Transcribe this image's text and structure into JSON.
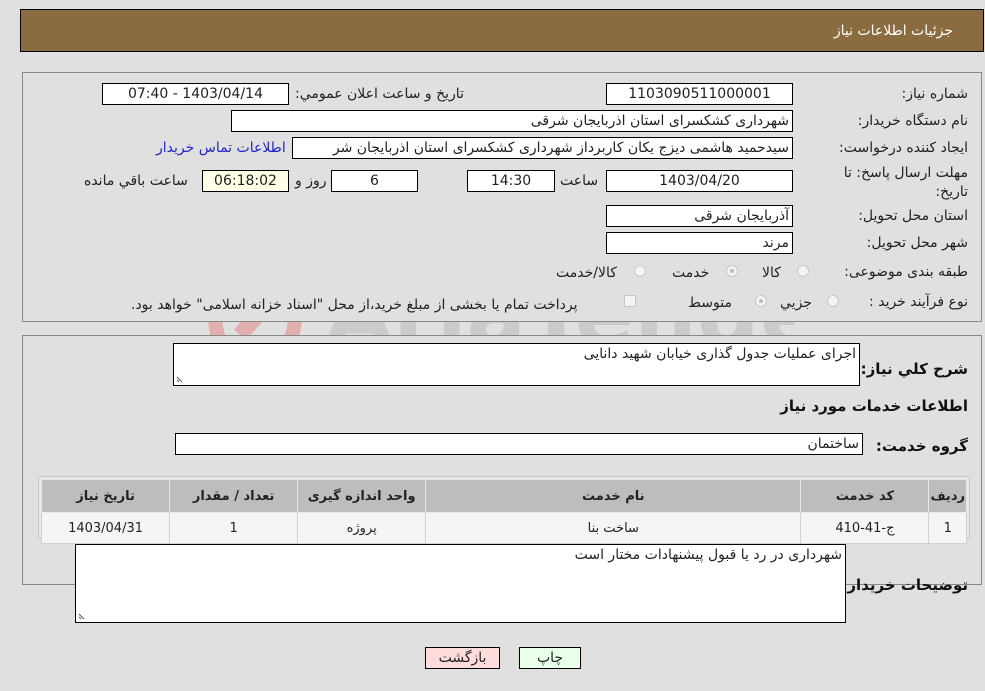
{
  "header": {
    "title": "جزئیات اطلاعات نیاز"
  },
  "form": {
    "need_number": {
      "label": "شماره نیاز:",
      "value": "1103090511000001"
    },
    "announce_datetime": {
      "label": "تاریخ و ساعت اعلان عمومي:",
      "value": "1403/04/14 - 07:40"
    },
    "buyer_org": {
      "label": "نام دستگاه خريدار:",
      "value": "شهرداری کشکسرای استان اذربایجان شرقی"
    },
    "requester": {
      "label": "ایجاد کننده درخواست:",
      "value": "سیدحمید هاشمی دیزج یکان کاربرداز شهرداری کشکسرای استان اذربایجان شر"
    },
    "buyer_contact_link": "اطلاعات تماس خريدار",
    "deadline": {
      "label": "مهلت ارسال پاسخ: تا تاریخ:",
      "date": "1403/04/20",
      "time_label": "ساعت",
      "time": "14:30",
      "days": "6",
      "days_label": "روز و",
      "remaining": "06:18:02",
      "remaining_label": "ساعت باقي مانده"
    },
    "delivery_province": {
      "label": "استان محل تحویل:",
      "value": "آذربایجان شرقی"
    },
    "delivery_city": {
      "label": "شهر محل تحویل:",
      "value": "مرند"
    },
    "category": {
      "label": "طبقه بندی موضوعی:",
      "options": [
        "کالا",
        "خدمت",
        "کالا/خدمت"
      ],
      "selected": "خدمت"
    },
    "purchase_type": {
      "label": "نوع فرآیند خرید :",
      "options": [
        "جزيي",
        "متوسط"
      ],
      "selected": "متوسط",
      "treasury_note": "پرداخت تمام یا بخشی از مبلغ خرید،از محل \"اسناد خزانه اسلامی\" خواهد بود."
    }
  },
  "details": {
    "description_label": "شرح كلي نياز:",
    "description": "اجرای عملیات جدول گذاری خیابان شهید دانایی",
    "services_heading": "اطلاعات خدمات مورد نياز",
    "service_group_label": "گروه خدمت:",
    "service_group": "ساختمان",
    "table": {
      "headers": [
        "رديف",
        "کد خدمت",
        "نام خدمت",
        "واحد اندازه گیری",
        "تعداد / مقدار",
        "تاریخ نیاز"
      ],
      "rows": [
        [
          "1",
          "ج-41-410",
          "ساخت بنا",
          "پروژه",
          "1",
          "1403/04/31"
        ]
      ]
    },
    "buyer_notes_label": "توضيحات خريدار:",
    "buyer_notes": "شهرداری در رد یا قبول پیشنهادات مختار است"
  },
  "buttons": {
    "print": "چاپ",
    "back": "بازگشت"
  },
  "colors": {
    "header_bg": "#8b6b40",
    "link": "#2222cc",
    "print_bg": "#eaffea",
    "back_bg": "#ffdcdc",
    "remaining_bg": "#ffffe8"
  },
  "watermark": {
    "text": "AriaTender.neT"
  }
}
